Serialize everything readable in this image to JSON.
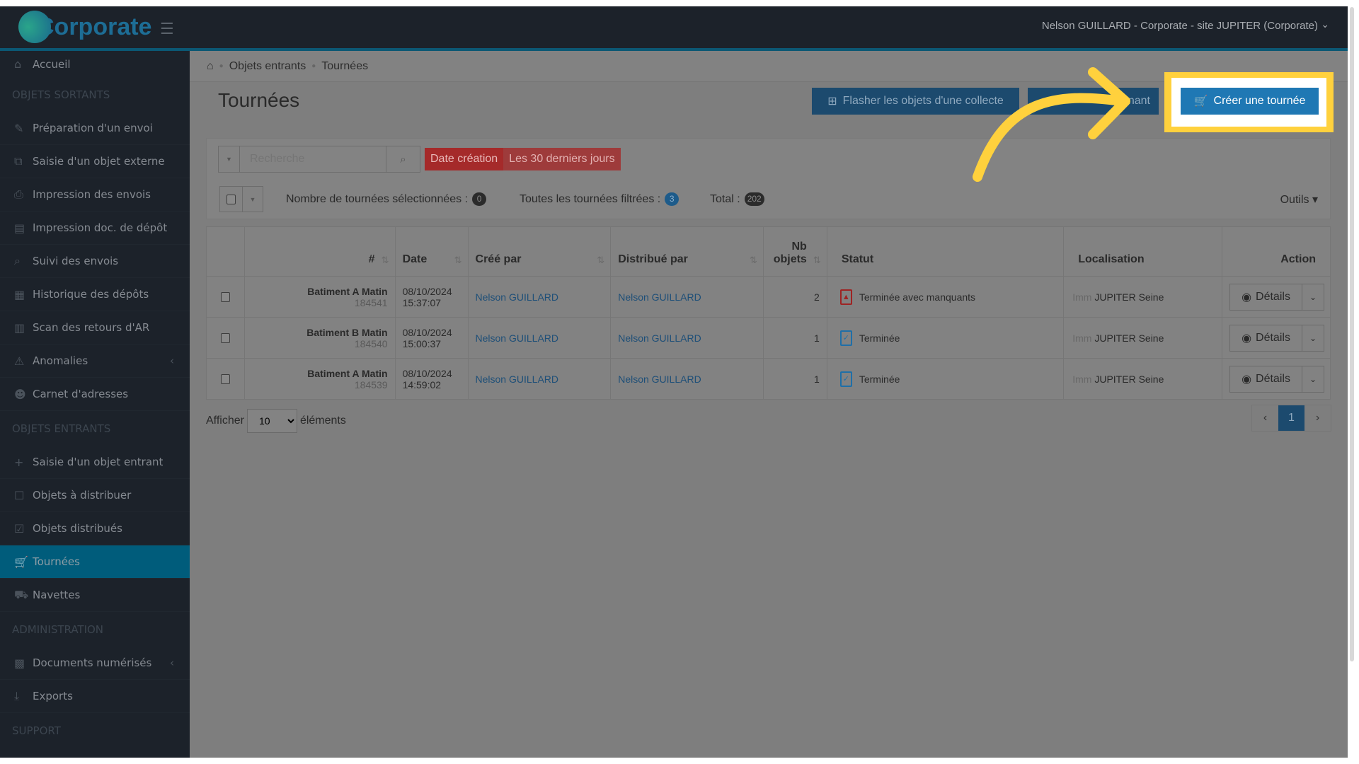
{
  "header": {
    "logo_text": "Corporate",
    "user": "Nelson GUILLARD - Corporate - site JUPITER (Corporate)"
  },
  "sidebar": {
    "items": [
      {
        "type": "item",
        "label": "Accueil",
        "icon": "home-icon",
        "glyph": "⌂"
      },
      {
        "type": "head",
        "label": "OBJETS SORTANTS"
      },
      {
        "type": "item",
        "label": "Préparation d'un envoi",
        "icon": "pencil-icon",
        "glyph": "✎"
      },
      {
        "type": "item",
        "label": "Saisie d'un objet externe",
        "icon": "external-edit-icon",
        "glyph": "⧉"
      },
      {
        "type": "item",
        "label": "Impression des envois",
        "icon": "print-icon",
        "glyph": "⎙"
      },
      {
        "type": "item",
        "label": "Impression doc. de dépôt",
        "icon": "document-icon",
        "glyph": "▤"
      },
      {
        "type": "item",
        "label": "Suivi des envois",
        "icon": "search-icon",
        "glyph": "⌕"
      },
      {
        "type": "item",
        "label": "Historique des dépôts",
        "icon": "calendar-icon",
        "glyph": "▦"
      },
      {
        "type": "item",
        "label": "Scan des retours d'AR",
        "icon": "barcode-icon",
        "glyph": "▥"
      },
      {
        "type": "item",
        "label": "Anomalies",
        "icon": "warning-icon",
        "glyph": "⚠",
        "caret": "‹"
      },
      {
        "type": "item",
        "label": "Carnet d'adresses",
        "icon": "users-icon",
        "glyph": "☻"
      },
      {
        "type": "head",
        "label": "OBJETS ENTRANTS"
      },
      {
        "type": "item",
        "label": "Saisie d'un objet entrant",
        "icon": "plus-icon",
        "glyph": "+"
      },
      {
        "type": "item",
        "label": "Objets à distribuer",
        "icon": "square-icon",
        "glyph": "☐"
      },
      {
        "type": "item",
        "label": "Objets distribués",
        "icon": "check-square-icon",
        "glyph": "☑"
      },
      {
        "type": "item",
        "label": "Tournées",
        "icon": "cart-icon",
        "glyph": "🛒",
        "active": true
      },
      {
        "type": "item",
        "label": "Navettes",
        "icon": "truck-icon",
        "glyph": "⛟"
      },
      {
        "type": "head",
        "label": "ADMINISTRATION"
      },
      {
        "type": "item",
        "label": "Documents numérisés",
        "icon": "qrcode-icon",
        "glyph": "▩",
        "caret": "‹"
      },
      {
        "type": "item",
        "label": "Exports",
        "icon": "download-icon",
        "glyph": "⤓"
      },
      {
        "type": "head",
        "label": "SUPPORT"
      }
    ]
  },
  "breadcrumb": [
    "Objets entrants",
    "Tournées"
  ],
  "page": {
    "title": "Tournées"
  },
  "toolbar": {
    "flash_label": "Flasher les objets d'une collecte",
    "second_label_visible": "enant",
    "create_label": "Créer une tournée"
  },
  "filters": {
    "search_placeholder": "Recherche",
    "badge_key": "Date création",
    "badge_value": "Les 30 derniers jours"
  },
  "counts": {
    "selected_label": "Nombre de tournées sélectionnées :",
    "selected": "0",
    "filtered_label": "Toutes les tournées filtrées :",
    "filtered": "3",
    "total_label": "Total :",
    "total": "202",
    "tools_label": "Outils"
  },
  "table": {
    "headers": {
      "id": "#",
      "date": "Date",
      "created_by": "Créé par",
      "distributed_by": "Distribué par",
      "nb1": "Nb",
      "nb2": "objets",
      "status": "Statut",
      "location": "Localisation",
      "action": "Action"
    },
    "rows": [
      {
        "name": "Batiment A Matin",
        "id": "184541",
        "date": "08/10/2024",
        "time": "15:37:07",
        "created_by": "Nelson GUILLARD",
        "distributed_by": "Nelson GUILLARD",
        "nb": "2",
        "status": "Terminée avec manquants",
        "status_color": "#9e2323",
        "location_prefix": "Imm",
        "location": "JUPITER Seine",
        "action": "Détails"
      },
      {
        "name": "Batiment B Matin",
        "id": "184540",
        "date": "08/10/2024",
        "time": "15:00:37",
        "created_by": "Nelson GUILLARD",
        "distributed_by": "Nelson GUILLARD",
        "nb": "1",
        "status": "Terminée",
        "status_color": "#1f6fa8",
        "location_prefix": "Imm",
        "location": "JUPITER Seine",
        "action": "Détails"
      },
      {
        "name": "Batiment A Matin",
        "id": "184539",
        "date": "08/10/2024",
        "time": "14:59:02",
        "created_by": "Nelson GUILLARD",
        "distributed_by": "Nelson GUILLARD",
        "nb": "1",
        "status": "Terminée",
        "status_color": "#1f6fa8",
        "location_prefix": "Imm",
        "location": "JUPITER Seine",
        "action": "Détails"
      }
    ]
  },
  "footer": {
    "show_label": "Afficher",
    "page_size": "10",
    "elements_label": "éléments",
    "current_page": "1"
  },
  "colors": {
    "highlight": "#ffd13d",
    "primary": "#1f78b4",
    "sidebar_active": "#005c7b"
  }
}
